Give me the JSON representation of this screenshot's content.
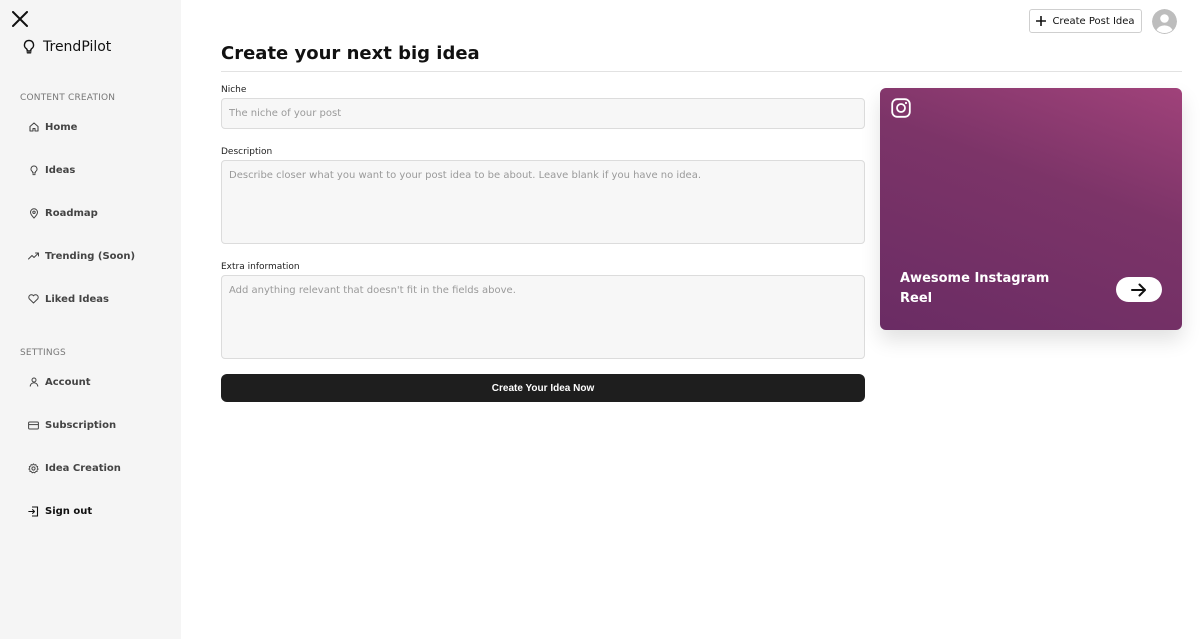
{
  "sidebar": {
    "brand": "TrendPilot",
    "sections": [
      {
        "label": "CONTENT CREATION",
        "items": [
          {
            "label": "Home",
            "icon": "home-icon"
          },
          {
            "label": "Ideas",
            "icon": "lightbulb-icon"
          },
          {
            "label": "Roadmap",
            "icon": "map-pin-icon"
          },
          {
            "label": "Trending (Soon)",
            "icon": "trending-icon"
          },
          {
            "label": "Liked Ideas",
            "icon": "heart-icon"
          }
        ]
      },
      {
        "label": "SETTINGS",
        "items": [
          {
            "label": "Account",
            "icon": "user-icon"
          },
          {
            "label": "Subscription",
            "icon": "credit-card-icon"
          },
          {
            "label": "Idea Creation",
            "icon": "gear-icon"
          }
        ]
      }
    ],
    "signout": "Sign out"
  },
  "header": {
    "create_button": "Create Post Idea"
  },
  "main": {
    "title": "Create your next big idea",
    "fields": [
      {
        "label": "Niche",
        "placeholder": "The niche of your post"
      },
      {
        "label": "Description",
        "placeholder": "Describe closer what you want to your post idea to be about. Leave blank if you have no idea."
      },
      {
        "label": "Extra information",
        "placeholder": "Add anything relevant that doesn't fit in the fields above."
      }
    ],
    "submit": "Create Your Idea Now"
  },
  "card": {
    "title": "Awesome Instagram Reel",
    "icon": "instagram-icon"
  },
  "colors": {
    "sidebar_bg": "#f5f5f5",
    "button_dark": "#1e1e1e",
    "card_gradient_start": "#a0427a",
    "card_gradient_end": "#6a2c64"
  }
}
